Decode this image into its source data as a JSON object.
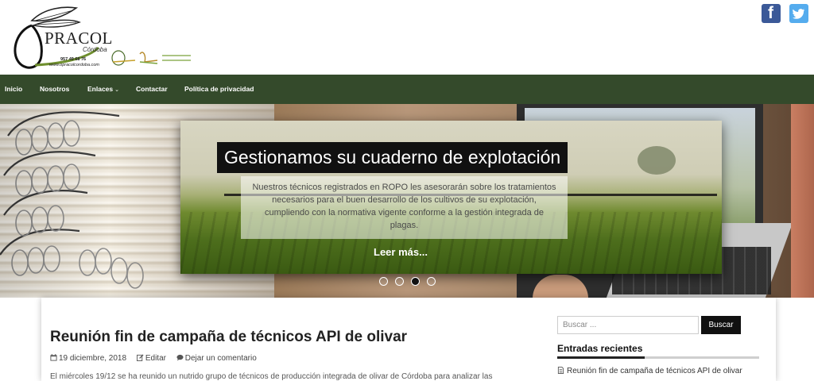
{
  "header": {
    "logo": {
      "name": "PRACOL",
      "city": "Córdoba",
      "phone": "957 49 68 76",
      "web": "www.opracolcordoba.com"
    },
    "social": [
      {
        "name": "facebook",
        "icon": "facebook-icon",
        "color": "#3b5998"
      },
      {
        "name": "twitter",
        "icon": "twitter-icon",
        "color": "#55acee"
      }
    ]
  },
  "nav": {
    "items": [
      {
        "label": "Inicio"
      },
      {
        "label": "Nosotros"
      },
      {
        "label": "Enlaces",
        "has_dropdown": true
      },
      {
        "label": "Contactar"
      },
      {
        "label": "Política de privacidad"
      }
    ],
    "background": "#344a2b"
  },
  "slider": {
    "title": "Gestionamos su cuaderno de explotación",
    "text": "Nuestros técnicos registrados en ROPO les asesorarán sobre los tratamientos necesarios para el buen desarrollo de los cultivos de su explotación, cumpliendo con la normativa vigente conforme a la gestión integrada de plagas.",
    "more_label": "Leer más...",
    "dots": 4,
    "active_dot": 3
  },
  "post": {
    "title": "Reunión fin de campaña de técnicos API de olivar",
    "date": "19 diciembre, 2018",
    "edit_label": "Editar",
    "comment_label": "Dejar un comentario",
    "excerpt": "El miércoles 19/12 se ha reunido un nutrido grupo de técnicos de producción integrada de olivar de Córdoba para analizar las"
  },
  "sidebar": {
    "search_placeholder": "Buscar ...",
    "search_button": "Buscar",
    "recent_title": "Entradas recientes",
    "recent_items": [
      "Reunión fin de campaña de técnicos API de olivar"
    ]
  }
}
